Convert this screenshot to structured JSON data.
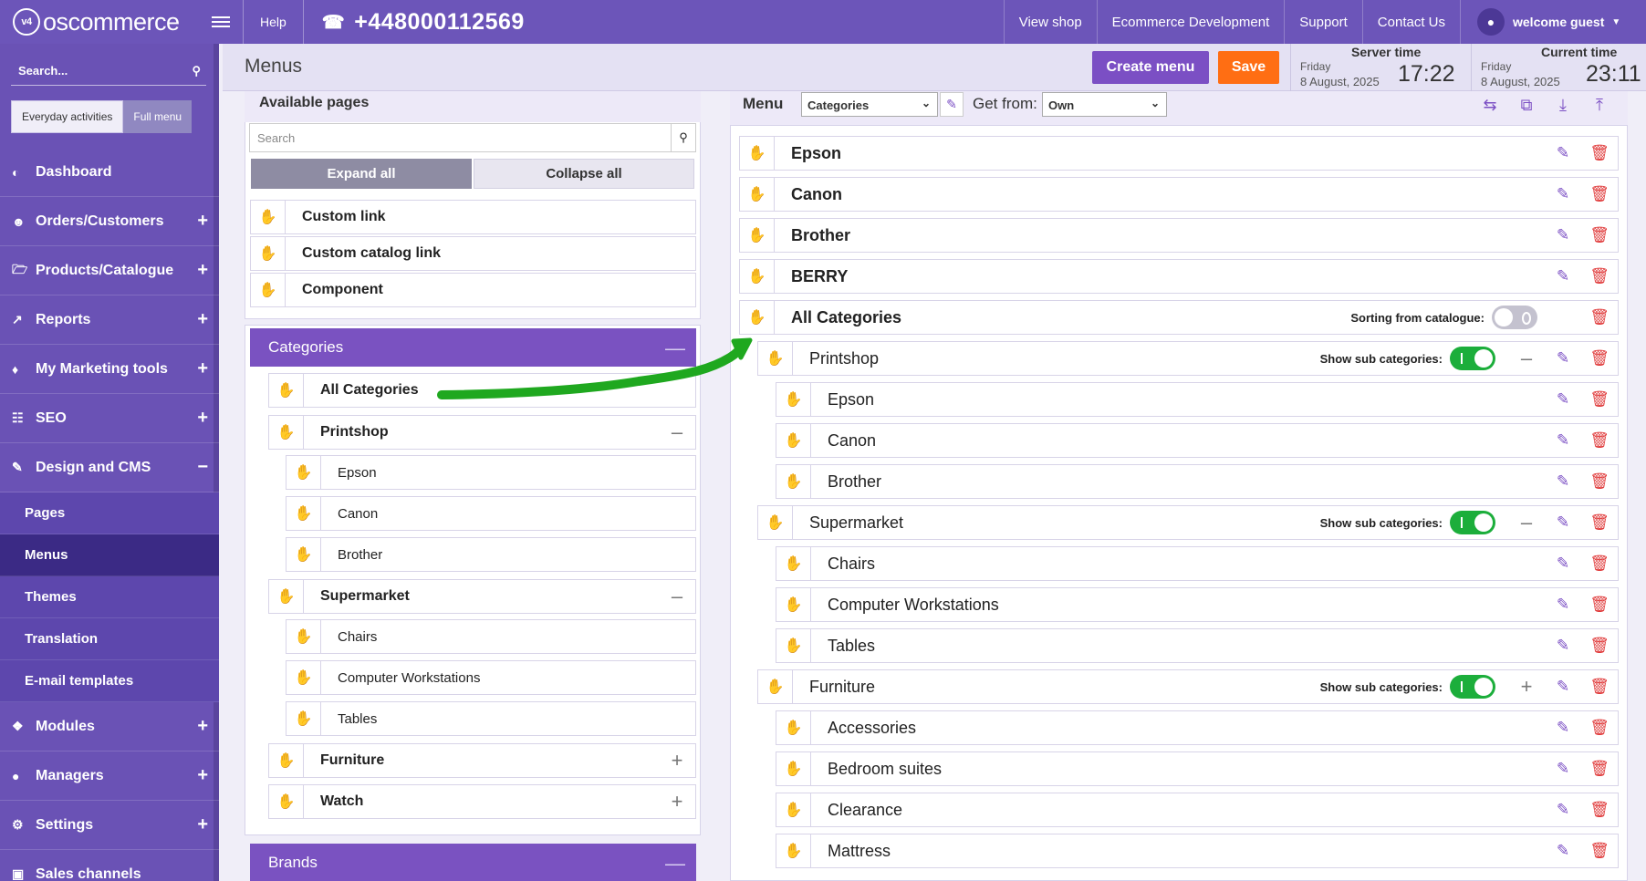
{
  "topbar": {
    "logo_text": "oscommerce",
    "logo_mark": "v4",
    "help": "Help",
    "phone": "+448000112569",
    "links": [
      "View shop",
      "Ecommerce Development",
      "Support",
      "Contact Us"
    ],
    "user": "welcome guest"
  },
  "sidebar": {
    "search_placeholder": "Search...",
    "toggle": {
      "everyday": "Everyday activities",
      "full": "Full menu"
    },
    "items": [
      {
        "label": "Dashboard",
        "icon": "dashboard-icon"
      },
      {
        "label": "Orders/Customers",
        "icon": "users-icon",
        "expand": "+"
      },
      {
        "label": "Products/Catalogue",
        "icon": "folder-icon",
        "expand": "+"
      },
      {
        "label": "Reports",
        "icon": "chart-line-icon",
        "expand": "+"
      },
      {
        "label": "My Marketing tools",
        "icon": "tag-icon",
        "expand": "+"
      },
      {
        "label": "SEO",
        "icon": "sitemap-icon",
        "expand": "+"
      },
      {
        "label": "Design and CMS",
        "icon": "brush-icon",
        "expand": "−"
      }
    ],
    "sub_items": [
      "Pages",
      "Menus",
      "Themes",
      "Translation",
      "E-mail templates"
    ],
    "items_after": [
      {
        "label": "Modules",
        "icon": "puzzle-icon",
        "expand": "+"
      },
      {
        "label": "Managers",
        "icon": "user-icon",
        "expand": "+"
      },
      {
        "label": "Settings",
        "icon": "gears-icon",
        "expand": "+"
      },
      {
        "label": "Sales channels",
        "icon": "monitor-icon"
      }
    ]
  },
  "header": {
    "title": "Menus",
    "create_menu": "Create menu",
    "save": "Save",
    "server_time": {
      "label": "Server time",
      "day": "Friday",
      "date": "8 August, 2025",
      "time": "17:22"
    },
    "current_time": {
      "label": "Current time",
      "day": "Friday",
      "date": "8 August, 2025",
      "time": "23:11"
    }
  },
  "available_pages": {
    "title": "Available pages",
    "search_placeholder": "Search",
    "expand_all": "Expand all",
    "collapse_all": "Collapse all",
    "links": [
      "Custom link",
      "Custom catalog link",
      "Component"
    ],
    "categories_title": "Categories",
    "categories": {
      "all": "All Categories",
      "printshop": "Printshop",
      "printshop_children": [
        "Epson",
        "Canon",
        "Brother"
      ],
      "supermarket": "Supermarket",
      "supermarket_children": [
        "Chairs",
        "Computer Workstations",
        "Tables"
      ],
      "furniture": "Furniture",
      "watch": "Watch"
    },
    "brands_title": "Brands"
  },
  "menu_editor": {
    "menu_label": "Menu",
    "menu_select": "Categories",
    "get_from_label": "Get from:",
    "get_from_select": "Own",
    "top_items": [
      "Epson",
      "Canon",
      "Brother",
      "BERRY"
    ],
    "all_categories": "All Categories",
    "sorting_label": "Sorting from catalogue:",
    "show_sub_label": "Show sub categories:",
    "printshop": "Printshop",
    "printshop_children": [
      "Epson",
      "Canon",
      "Brother"
    ],
    "supermarket": "Supermarket",
    "supermarket_children": [
      "Chairs",
      "Computer Workstations",
      "Tables"
    ],
    "furniture": "Furniture",
    "furniture_children": [
      "Accessories",
      "Bedroom suites",
      "Clearance",
      "Mattress"
    ]
  },
  "colors": {
    "topbar": "#6c55b9",
    "sidebar": "#6a52b5",
    "accent": "#7b4fc4",
    "save": "#ff6e13",
    "toggle_on": "#1cae3b",
    "delete": "#e03b3b",
    "arrow": "#1fa81f"
  }
}
